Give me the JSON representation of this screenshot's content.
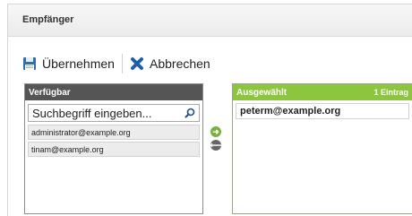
{
  "dialog": {
    "title": "Empfänger"
  },
  "toolbar": {
    "apply_label": "Übernehmen",
    "cancel_label": "Abbrechen"
  },
  "available": {
    "header": "Verfügbar",
    "search_placeholder": "Suchbegriff eingeben...",
    "items": [
      "administrator@example.org",
      "tinam@example.org"
    ]
  },
  "selected": {
    "header": "Ausgewählt",
    "count_label": "1 Eintrag",
    "items": [
      "peterm@example.org"
    ]
  },
  "colors": {
    "header_available": "#555555",
    "header_selected": "#8cc63f",
    "arrow_right": "#79b13b",
    "cancel_icon": "#1f5fa8"
  },
  "icons": [
    "save-icon",
    "cancel-x-icon",
    "search-icon",
    "move-right-icon",
    "move-left-icon"
  ]
}
